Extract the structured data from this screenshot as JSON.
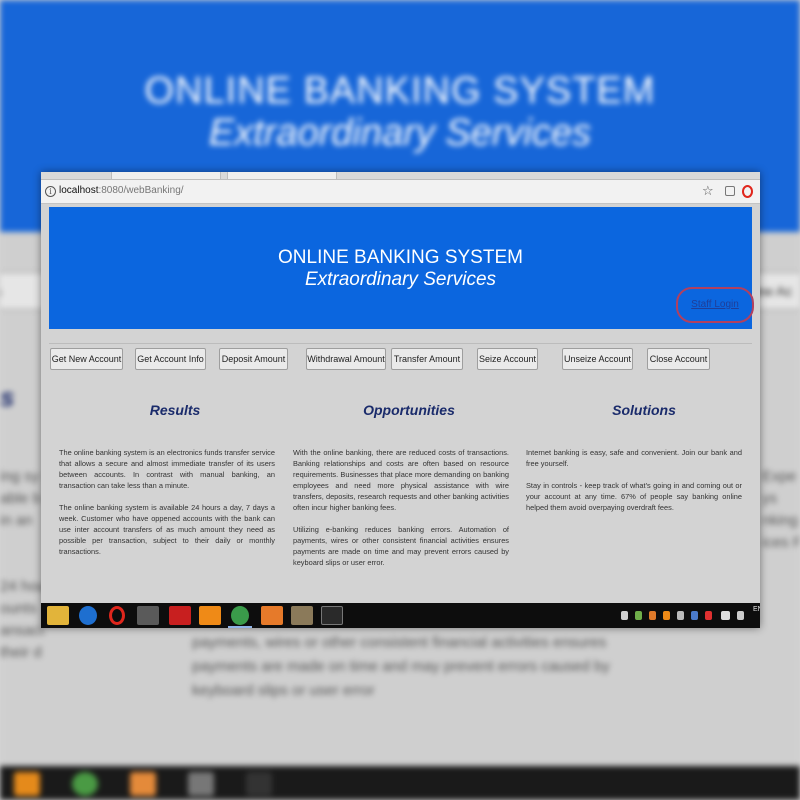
{
  "browser": {
    "url_host": "localhost",
    "url_rest": ":8080/webBanking/",
    "star_icon": "star-icon",
    "info_icon": "info-icon"
  },
  "banner": {
    "title": "ONLINE BANKING SYSTEM",
    "subtitle": "Extraordinary Services",
    "staff_login": "Staff Login",
    "color": "#0b66df"
  },
  "toolbar": {
    "buttons": [
      "Get New Account",
      "Get Account Info",
      "Deposit Amount",
      "Withdrawal Amount",
      "Transfer Amount",
      "Seize Account",
      "Unseize Account",
      "Close Account"
    ]
  },
  "columns": [
    {
      "heading": "Results",
      "paragraphs": [
        "The online banking system is an electronics funds transfer service that allows a secure and almost immediate transfer of its users between accounts. In contrast with manual banking, an transaction can take less than a minute.",
        "The online banking system is available 24 hours a day, 7 days a week. Customer who have oppened accounts with the bank can use inter account transfers of as much amount they need as possible per transaction, subject to their daily or monthly transactions."
      ]
    },
    {
      "heading": "Opportunities",
      "paragraphs": [
        "With the online banking, there are reduced costs of transactions. Banking relationships and costs are often based on resource requirements. Businesses that place more demanding on banking employees and need more physical assistance with wire transfers, deposits, research requests and other banking activities often incur higher banking fees.",
        "Utilizing e-banking reduces banking errors. Automation of payments, wires or other consistent financial activities ensures payments are made on time and may prevent errors caused by keyboard slips or user error."
      ]
    },
    {
      "heading": "Solutions",
      "paragraphs": [
        "Internet banking is easy, safe and convenient. Join our bank and free yourself.",
        "Stay in controls - keep track of what's going in and coming out or your account at any time. 67% of people say banking online helped them avoid overpaying overdraft fees."
      ]
    }
  ],
  "taskbar": {
    "apps": [
      "file-explorer-icon",
      "edge-icon",
      "opera-icon",
      "image-viewer-icon",
      "filezilla-icon",
      "vlc-icon",
      "chrome-icon",
      "xampp-icon",
      "photo-app-icon",
      "command-prompt-icon"
    ],
    "tray_text": "EN"
  },
  "background": {
    "edge_left": "ts",
    "edge_right": "ew Ac",
    "heading_left": "s",
    "lines_left": [
      "ing sy",
      "able b",
      "in an",
      "",
      "24 hou",
      "ounts",
      "ansact",
      "their d"
    ],
    "lines_right": [
      "Expe Fe",
      "ys",
      "nking",
      "",
      "ices F"
    ],
    "bottom_lines": [
      "payments, wires or other consistent financial activities ensures",
      "payments are made on time and may prevent errors caused by",
      "keyboard slips or user error"
    ]
  }
}
